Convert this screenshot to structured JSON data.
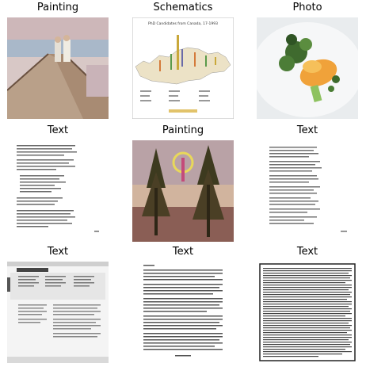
{
  "grid": {
    "cells": [
      {
        "label": "Painting",
        "icon": "painting-boardwalk-image"
      },
      {
        "label": "Schematics",
        "icon": "schematic-map-chart-image",
        "figure_title": "PhD Candidates from Canada, 17-1993"
      },
      {
        "label": "Photo",
        "icon": "food-plate-photo"
      },
      {
        "label": "Text",
        "icon": "text-page-image"
      },
      {
        "label": "Painting",
        "icon": "painting-trees-image"
      },
      {
        "label": "Text",
        "icon": "text-page-image"
      },
      {
        "label": "Text",
        "icon": "magazine-page-image"
      },
      {
        "label": "Text",
        "icon": "book-page-image"
      },
      {
        "label": "Text",
        "icon": "dense-text-page-image"
      }
    ]
  }
}
